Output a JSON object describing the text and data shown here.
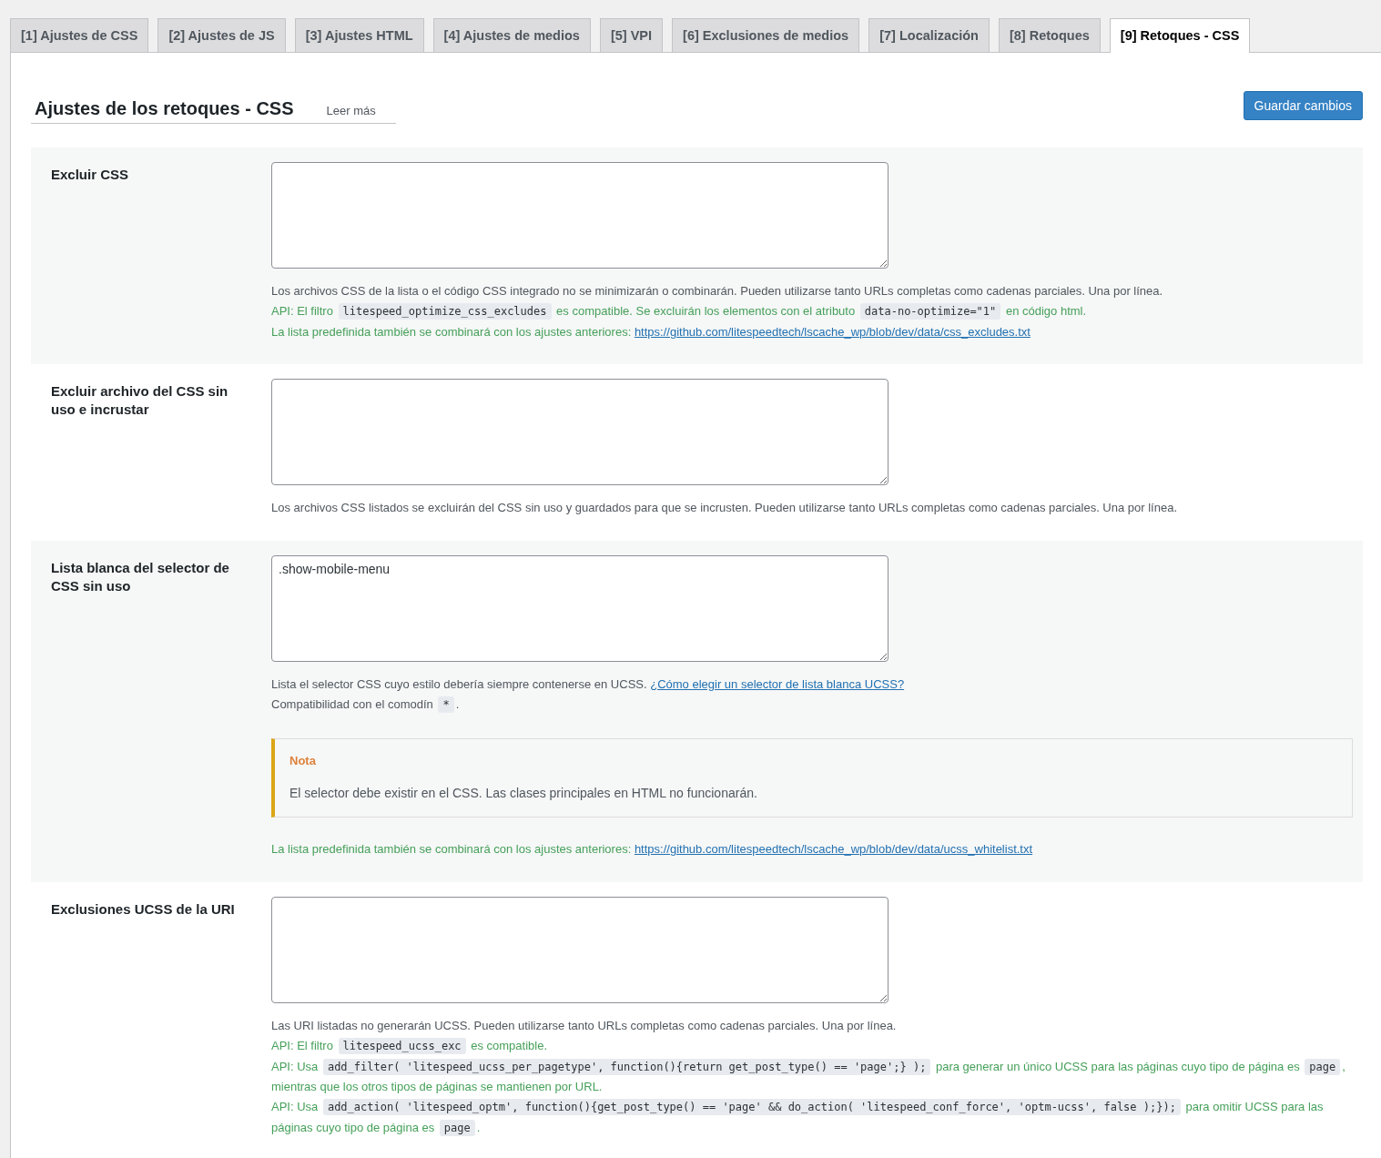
{
  "tabs": [
    {
      "label": "[1] Ajustes de CSS",
      "selected": false
    },
    {
      "label": "[2] Ajustes de JS",
      "selected": false
    },
    {
      "label": "[3] Ajustes HTML",
      "selected": false
    },
    {
      "label": "[4] Ajustes de medios",
      "selected": false
    },
    {
      "label": "[5] VPI",
      "selected": false
    },
    {
      "label": "[6] Exclusiones de medios",
      "selected": false
    },
    {
      "label": "[7] Localización",
      "selected": false
    },
    {
      "label": "[8] Retoques",
      "selected": false
    },
    {
      "label": "[9] Retoques - CSS",
      "selected": true
    }
  ],
  "header": {
    "title": "Ajustes de los retoques - CSS",
    "read_more": "Leer más",
    "save_button": "Guardar cambios"
  },
  "sections": [
    {
      "label": "Excluir CSS",
      "help": [
        {
          "kind": "muted",
          "parts": [
            {
              "kind": "text",
              "text": "Los archivos CSS de la lista o el código CSS integrado no se minimizarán o combinarán. Pueden utilizarse tanto URLs completas como cadenas parciales. Una por línea."
            }
          ]
        },
        {
          "kind": "api",
          "parts": [
            {
              "kind": "text",
              "text": "API: El filtro "
            },
            {
              "kind": "code",
              "text": "litespeed_optimize_css_excludes"
            },
            {
              "kind": "text",
              "text": " es compatible. Se excluirán los elementos con el atributo "
            },
            {
              "kind": "code",
              "text": "data-no-optimize=\"1\""
            },
            {
              "kind": "text",
              "text": " en código html."
            }
          ]
        },
        {
          "kind": "api",
          "parts": [
            {
              "kind": "text",
              "text": "La lista predefinida también se combinará con los ajustes anteriores: "
            },
            {
              "kind": "link",
              "text": "https://github.com/litespeedtech/lscache_wp/blob/dev/data/css_excludes.txt"
            }
          ]
        }
      ]
    },
    {
      "label": "Excluir archivo del CSS sin uso e incrustar",
      "help": [
        {
          "kind": "muted",
          "parts": [
            {
              "kind": "text",
              "text": "Los archivos CSS listados se excluirán del CSS sin uso y guardados para que se incrusten. Pueden utilizarse tanto URLs completas como cadenas parciales. Una por línea."
            }
          ]
        }
      ]
    },
    {
      "label": "Lista blanca del selector de CSS sin uso",
      "value": ".show-mobile-menu",
      "help": [
        {
          "kind": "muted",
          "parts": [
            {
              "kind": "text",
              "text": "Lista el selector CSS cuyo estilo debería siempre contenerse en UCSS. "
            },
            {
              "kind": "link",
              "text": "¿Cómo elegir un selector de lista blanca UCSS?"
            }
          ]
        },
        {
          "kind": "muted",
          "parts": [
            {
              "kind": "text",
              "text": "Compatibilidad con el comodín "
            },
            {
              "kind": "code",
              "text": "*"
            },
            {
              "kind": "text",
              "text": "."
            }
          ]
        }
      ],
      "note": {
        "title": "Nota",
        "text": "El selector debe existir en el CSS. Las clases principales en HTML no funcionarán."
      },
      "help_after": [
        {
          "kind": "api",
          "parts": [
            {
              "kind": "text",
              "text": "La lista predefinida también se combinará con los ajustes anteriores: "
            },
            {
              "kind": "link",
              "text": "https://github.com/litespeedtech/lscache_wp/blob/dev/data/ucss_whitelist.txt"
            }
          ]
        }
      ]
    },
    {
      "label": "Exclusiones UCSS de la URI",
      "help": [
        {
          "kind": "muted",
          "parts": [
            {
              "kind": "text",
              "text": "Las URI listadas no generarán UCSS. Pueden utilizarse tanto URLs completas como cadenas parciales. Una por línea."
            }
          ]
        },
        {
          "kind": "api",
          "parts": [
            {
              "kind": "text",
              "text": "API: El filtro "
            },
            {
              "kind": "code",
              "text": "litespeed_ucss_exc"
            },
            {
              "kind": "text",
              "text": " es compatible."
            }
          ]
        },
        {
          "kind": "api",
          "parts": [
            {
              "kind": "text",
              "text": "API: Usa "
            },
            {
              "kind": "code",
              "text": "add_filter( 'litespeed_ucss_per_pagetype', function(){return get_post_type() == 'page';} );"
            },
            {
              "kind": "text",
              "text": " para generar un único UCSS para las páginas cuyo tipo de página es "
            },
            {
              "kind": "code",
              "text": "page"
            },
            {
              "kind": "text",
              "text": ", mientras que los otros tipos de páginas se mantienen por URL."
            }
          ]
        },
        {
          "kind": "api",
          "parts": [
            {
              "kind": "text",
              "text": "API: Usa "
            },
            {
              "kind": "code",
              "text": "add_action( 'litespeed_optm', function(){get_post_type() == 'page' && do_action( 'litespeed_conf_force', 'optm-ucss', false );});"
            },
            {
              "kind": "text",
              "text": " para omitir UCSS para las páginas cuyo tipo de página es "
            },
            {
              "kind": "code",
              "text": "page"
            },
            {
              "kind": "text",
              "text": "."
            }
          ]
        }
      ]
    }
  ]
}
